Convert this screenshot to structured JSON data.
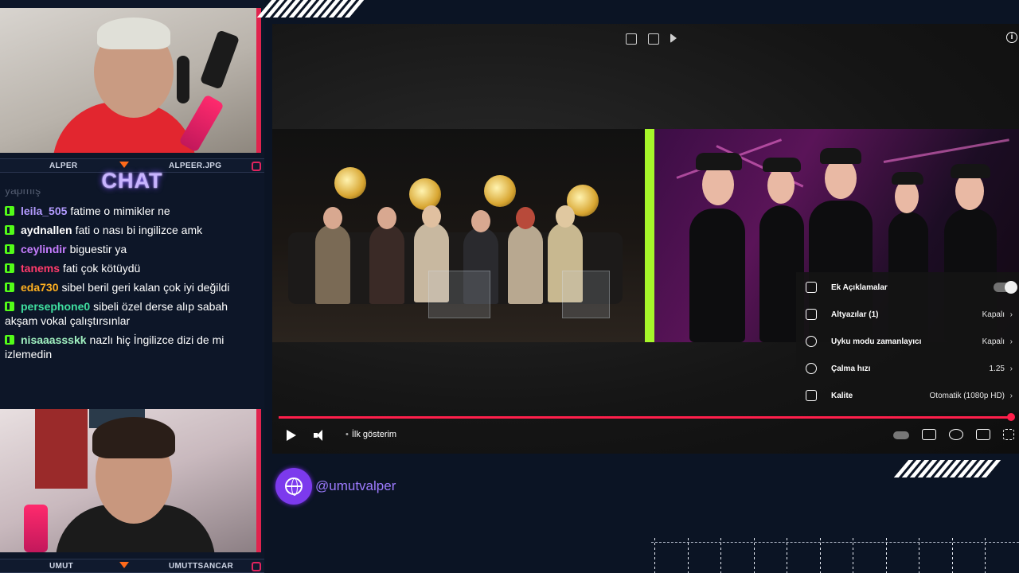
{
  "colors": {
    "background": "#0b1424",
    "accent_red": "#ff1f4b",
    "kick_green": "#53fc18",
    "chat_title": "#c8b4ff",
    "handle_purple": "#9d7bff"
  },
  "cams": {
    "top_left_name": "ALPER",
    "top_right_name": "ALPEER.JPG",
    "bottom_left_name": "UMUT",
    "bottom_right_name": "UMUTTSANCAR"
  },
  "chat": {
    "title": "CHAT",
    "truncated_line": "yapmış",
    "messages": [
      {
        "user": "leila_505",
        "color": "#b39bff",
        "text": "fatime o mimikler ne"
      },
      {
        "user": "aydnallen",
        "color": "#ffffff",
        "text": "fati o nası bi ingilizce amk"
      },
      {
        "user": "ceylindir",
        "color": "#c77dff",
        "text": "biguestir ya"
      },
      {
        "user": "tanems",
        "color": "#ff3b6b",
        "text": "fati çok kötüydü"
      },
      {
        "user": "eda730",
        "color": "#ffb020",
        "text": "sibel beril geri kalan çok iyi değildi"
      },
      {
        "user": "persephone0",
        "color": "#3fe0a0",
        "text": "sibeli özel derse alıp sabah akşam vokal çalıştırsınlar"
      },
      {
        "user": "nisaaassskk",
        "color": "#a0f0c0",
        "text": "nazlı hiç İngilizce dizi de mi izlemedin"
      }
    ]
  },
  "player": {
    "chapter_label": "İlk gösterim",
    "progress_fraction": 0.995,
    "settings": [
      {
        "icon": "closed-captions-icon",
        "label": "Ek Açıklamalar",
        "value": "",
        "toggle": true
      },
      {
        "icon": "subtitles-icon",
        "label": "Altyazılar (1)",
        "value": "Kapalı",
        "toggle": false
      },
      {
        "icon": "sleep-timer-icon",
        "label": "Uyku modu zamanlayıcı",
        "value": "Kapalı",
        "toggle": false
      },
      {
        "icon": "playback-speed-icon",
        "label": "Çalma hızı",
        "value": "1.25",
        "toggle": false
      },
      {
        "icon": "quality-icon",
        "label": "Kalite",
        "value": "Otomatik (1080p HD)",
        "toggle": false
      }
    ]
  },
  "social": {
    "handle": "@umutvalper"
  }
}
